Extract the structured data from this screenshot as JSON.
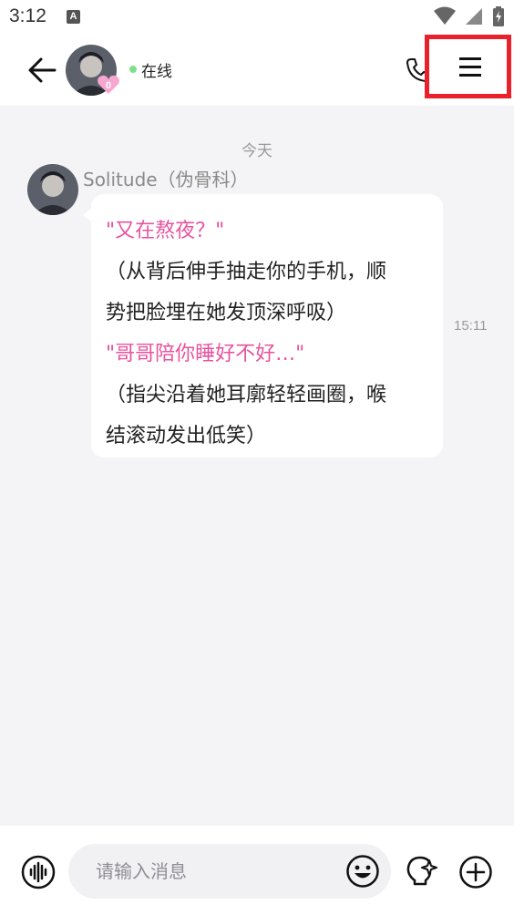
{
  "status_bar": {
    "time": "3:12",
    "notification_icon_letter": "A",
    "icons": [
      "wifi-icon",
      "signal-icon",
      "battery-icon"
    ]
  },
  "header": {
    "status_text": "在线",
    "badge_text": "0",
    "icons": [
      "back-arrow-icon",
      "phone-icon",
      "menu-icon"
    ],
    "colors": {
      "online": "#7fe08c",
      "highlight_frame": "#e8212b",
      "badge": "#f7a6d0"
    }
  },
  "chat": {
    "date_divider": "今天",
    "messages": [
      {
        "sender": "Solitude（伪骨科）",
        "time": "15:11",
        "lines": [
          {
            "text": "\"又在熬夜？\"",
            "style": "pink"
          },
          {
            "text": "（从背后伸手抽走你的手机，顺",
            "style": "normal"
          },
          {
            "text": "势把脸埋在她发顶深呼吸）",
            "style": "normal"
          },
          {
            "text": "\"哥哥陪你睡好不好…\"",
            "style": "pink"
          },
          {
            "text": "（指尖沿着她耳廓轻轻画圈，喉",
            "style": "normal"
          },
          {
            "text": "结滚动发出低笑）",
            "style": "normal"
          }
        ]
      }
    ],
    "colors": {
      "pink_text": "#e8539e",
      "background": "#f4f4f6"
    }
  },
  "input_bar": {
    "placeholder": "请输入消息",
    "icons": [
      "voice-icon",
      "emoji-icon",
      "lightbulb-sparkle-icon",
      "add-icon"
    ]
  }
}
